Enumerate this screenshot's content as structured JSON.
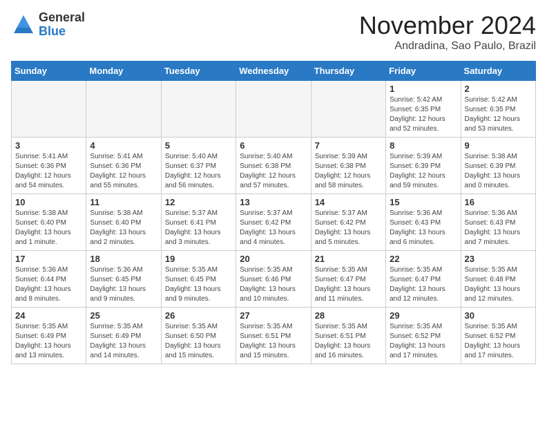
{
  "header": {
    "logo_general": "General",
    "logo_blue": "Blue",
    "month": "November 2024",
    "location": "Andradina, Sao Paulo, Brazil"
  },
  "weekdays": [
    "Sunday",
    "Monday",
    "Tuesday",
    "Wednesday",
    "Thursday",
    "Friday",
    "Saturday"
  ],
  "weeks": [
    [
      {
        "day": "",
        "detail": ""
      },
      {
        "day": "",
        "detail": ""
      },
      {
        "day": "",
        "detail": ""
      },
      {
        "day": "",
        "detail": ""
      },
      {
        "day": "",
        "detail": ""
      },
      {
        "day": "1",
        "detail": "Sunrise: 5:42 AM\nSunset: 6:35 PM\nDaylight: 12 hours\nand 52 minutes."
      },
      {
        "day": "2",
        "detail": "Sunrise: 5:42 AM\nSunset: 6:35 PM\nDaylight: 12 hours\nand 53 minutes."
      }
    ],
    [
      {
        "day": "3",
        "detail": "Sunrise: 5:41 AM\nSunset: 6:36 PM\nDaylight: 12 hours\nand 54 minutes."
      },
      {
        "day": "4",
        "detail": "Sunrise: 5:41 AM\nSunset: 6:36 PM\nDaylight: 12 hours\nand 55 minutes."
      },
      {
        "day": "5",
        "detail": "Sunrise: 5:40 AM\nSunset: 6:37 PM\nDaylight: 12 hours\nand 56 minutes."
      },
      {
        "day": "6",
        "detail": "Sunrise: 5:40 AM\nSunset: 6:38 PM\nDaylight: 12 hours\nand 57 minutes."
      },
      {
        "day": "7",
        "detail": "Sunrise: 5:39 AM\nSunset: 6:38 PM\nDaylight: 12 hours\nand 58 minutes."
      },
      {
        "day": "8",
        "detail": "Sunrise: 5:39 AM\nSunset: 6:39 PM\nDaylight: 12 hours\nand 59 minutes."
      },
      {
        "day": "9",
        "detail": "Sunrise: 5:38 AM\nSunset: 6:39 PM\nDaylight: 13 hours\nand 0 minutes."
      }
    ],
    [
      {
        "day": "10",
        "detail": "Sunrise: 5:38 AM\nSunset: 6:40 PM\nDaylight: 13 hours\nand 1 minute."
      },
      {
        "day": "11",
        "detail": "Sunrise: 5:38 AM\nSunset: 6:40 PM\nDaylight: 13 hours\nand 2 minutes."
      },
      {
        "day": "12",
        "detail": "Sunrise: 5:37 AM\nSunset: 6:41 PM\nDaylight: 13 hours\nand 3 minutes."
      },
      {
        "day": "13",
        "detail": "Sunrise: 5:37 AM\nSunset: 6:42 PM\nDaylight: 13 hours\nand 4 minutes."
      },
      {
        "day": "14",
        "detail": "Sunrise: 5:37 AM\nSunset: 6:42 PM\nDaylight: 13 hours\nand 5 minutes."
      },
      {
        "day": "15",
        "detail": "Sunrise: 5:36 AM\nSunset: 6:43 PM\nDaylight: 13 hours\nand 6 minutes."
      },
      {
        "day": "16",
        "detail": "Sunrise: 5:36 AM\nSunset: 6:43 PM\nDaylight: 13 hours\nand 7 minutes."
      }
    ],
    [
      {
        "day": "17",
        "detail": "Sunrise: 5:36 AM\nSunset: 6:44 PM\nDaylight: 13 hours\nand 8 minutes."
      },
      {
        "day": "18",
        "detail": "Sunrise: 5:36 AM\nSunset: 6:45 PM\nDaylight: 13 hours\nand 9 minutes."
      },
      {
        "day": "19",
        "detail": "Sunrise: 5:35 AM\nSunset: 6:45 PM\nDaylight: 13 hours\nand 9 minutes."
      },
      {
        "day": "20",
        "detail": "Sunrise: 5:35 AM\nSunset: 6:46 PM\nDaylight: 13 hours\nand 10 minutes."
      },
      {
        "day": "21",
        "detail": "Sunrise: 5:35 AM\nSunset: 6:47 PM\nDaylight: 13 hours\nand 11 minutes."
      },
      {
        "day": "22",
        "detail": "Sunrise: 5:35 AM\nSunset: 6:47 PM\nDaylight: 13 hours\nand 12 minutes."
      },
      {
        "day": "23",
        "detail": "Sunrise: 5:35 AM\nSunset: 6:48 PM\nDaylight: 13 hours\nand 12 minutes."
      }
    ],
    [
      {
        "day": "24",
        "detail": "Sunrise: 5:35 AM\nSunset: 6:49 PM\nDaylight: 13 hours\nand 13 minutes."
      },
      {
        "day": "25",
        "detail": "Sunrise: 5:35 AM\nSunset: 6:49 PM\nDaylight: 13 hours\nand 14 minutes."
      },
      {
        "day": "26",
        "detail": "Sunrise: 5:35 AM\nSunset: 6:50 PM\nDaylight: 13 hours\nand 15 minutes."
      },
      {
        "day": "27",
        "detail": "Sunrise: 5:35 AM\nSunset: 6:51 PM\nDaylight: 13 hours\nand 15 minutes."
      },
      {
        "day": "28",
        "detail": "Sunrise: 5:35 AM\nSunset: 6:51 PM\nDaylight: 13 hours\nand 16 minutes."
      },
      {
        "day": "29",
        "detail": "Sunrise: 5:35 AM\nSunset: 6:52 PM\nDaylight: 13 hours\nand 17 minutes."
      },
      {
        "day": "30",
        "detail": "Sunrise: 5:35 AM\nSunset: 6:52 PM\nDaylight: 13 hours\nand 17 minutes."
      }
    ]
  ]
}
